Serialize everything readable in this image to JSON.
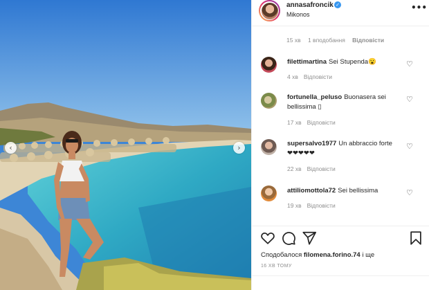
{
  "post": {
    "author": "annasafroncik",
    "location": "Mikonos",
    "more_icon": "•••",
    "verified_icon": "✓"
  },
  "photo": {
    "prev_icon": "‹",
    "next_icon": "›",
    "sky_color": "#3e86d6",
    "sea_color": "#34b6c8"
  },
  "caption_meta": {
    "time": "15 хв",
    "likes": "1 вподобання",
    "reply": "Відповісти"
  },
  "comments": [
    {
      "user": "filettimartina",
      "text": "Sei Stupenda😮",
      "time": "4 хв",
      "reply": "Відповісти"
    },
    {
      "user": "fortunella_peluso",
      "text": "Buonasera sei bellissima ▯",
      "time": "17 хв",
      "reply": "Відповісти"
    },
    {
      "user": "supersalvo1977",
      "text": "Un abbraccio forte ❤❤❤❤❤",
      "time": "22 хв",
      "reply": "Відповісти"
    },
    {
      "user": "attiliomottola72",
      "text": "Sei bellissima",
      "time": "19 хв",
      "reply": "Відповісти"
    }
  ],
  "heart_icon": "♡",
  "likes_summary": {
    "prefix": "Сподобалося",
    "user": "filomena.forino.74",
    "suffix": "і ще"
  },
  "post_time": "16 ХВ ТОМУ"
}
